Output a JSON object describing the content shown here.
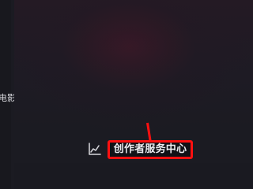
{
  "sidebar": {
    "partial_label": "电影"
  },
  "toolbar": {
    "analytics_icon": "line-chart-icon",
    "creator_center_label": "创作者服务中心"
  },
  "colors": {
    "background": "#1b1b22",
    "highlight": "#ff1010",
    "text": "#ececf0"
  }
}
